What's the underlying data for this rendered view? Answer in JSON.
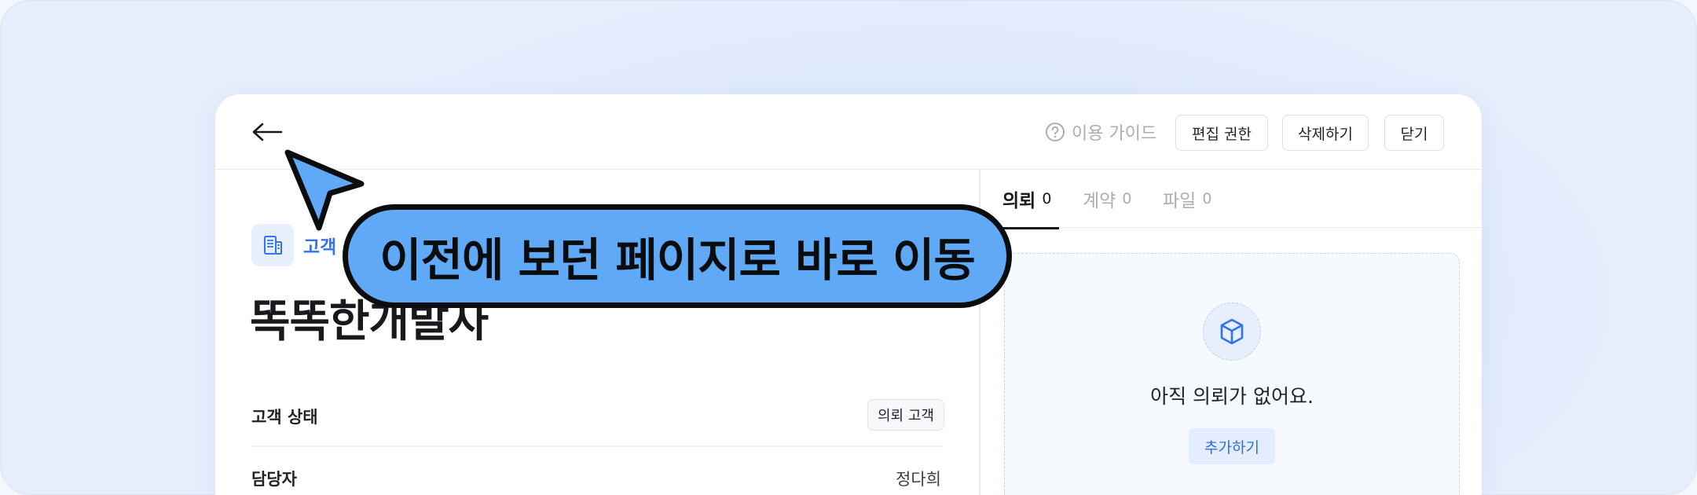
{
  "header": {
    "guide_label": "이용 가이드",
    "edit_permission_label": "편집 권한",
    "delete_label": "삭제하기",
    "close_label": "닫기"
  },
  "customer": {
    "type_label": "고객",
    "name": "똑똑한개발자",
    "status_label": "고객 상태",
    "status_value": "의뢰 고객",
    "manager_label": "담당자",
    "manager_value": "정다희"
  },
  "tabs": [
    {
      "label": "의뢰",
      "count": "0",
      "active": true
    },
    {
      "label": "계약",
      "count": "0",
      "active": false
    },
    {
      "label": "파일",
      "count": "0",
      "active": false
    }
  ],
  "empty_state": {
    "message": "아직 의뢰가 없어요.",
    "add_label": "추가하기"
  },
  "callout": {
    "text": "이전에 보던 페이지로 바로 이동"
  },
  "colors": {
    "accent": "#2f74ee",
    "callout": "#5fa9f7"
  }
}
